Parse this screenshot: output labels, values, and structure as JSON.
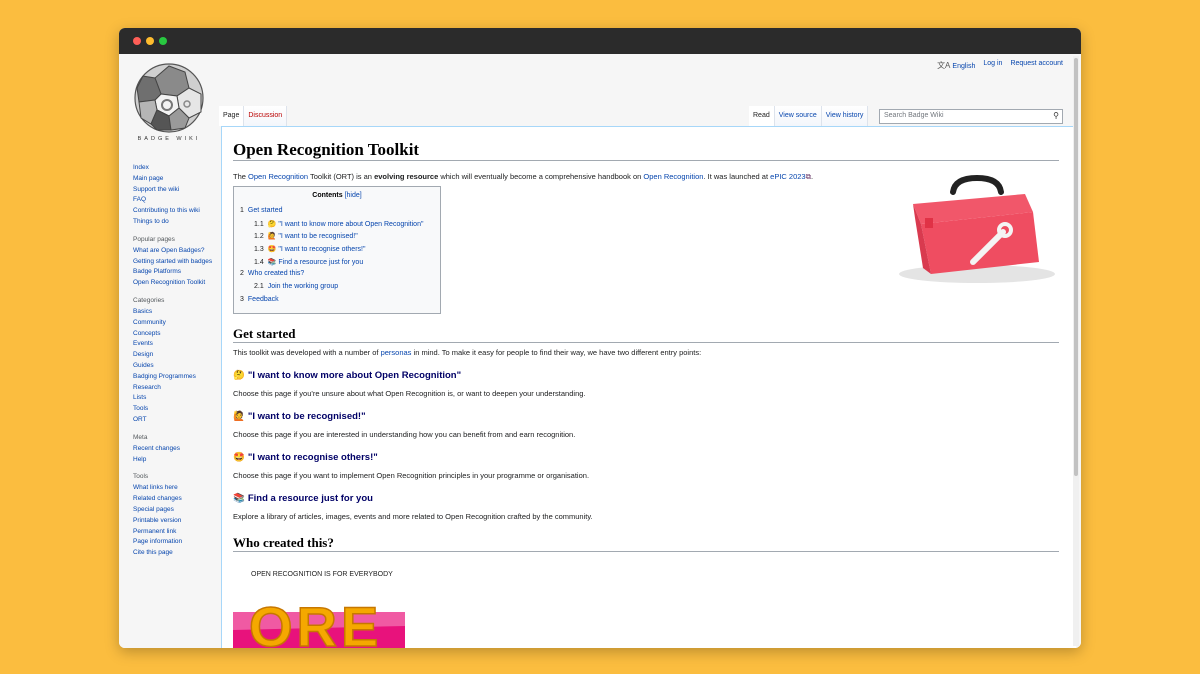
{
  "personal": {
    "language": "English",
    "login": "Log in",
    "request": "Request account"
  },
  "logo": {
    "text": "BADGE WIKI"
  },
  "tabs": {
    "page": "Page",
    "discussion": "Discussion",
    "read": "Read",
    "view_source": "View source",
    "view_history": "View history"
  },
  "search": {
    "placeholder": "Search Badge Wiki"
  },
  "sidebar": {
    "nav": [
      "Index",
      "Main page",
      "Support the wiki",
      "FAQ",
      "Contributing to this wiki",
      "Things to do"
    ],
    "popular_heading": "Popular pages",
    "popular": [
      "What are Open Badges?",
      "Getting started with badges",
      "Badge Platforms",
      "Open Recognition Toolkit"
    ],
    "categories_heading": "Categories",
    "categories": [
      "Basics",
      "Community",
      "Concepts",
      "Events",
      "Design",
      "Guides",
      "Badging Programmes",
      "Research",
      "Lists",
      "Tools",
      "ORT"
    ],
    "meta_heading": "Meta",
    "meta": [
      "Recent changes",
      "Help"
    ],
    "tools_heading": "Tools",
    "tools": [
      "What links here",
      "Related changes",
      "Special pages",
      "Printable version",
      "Permanent link",
      "Page information",
      "Cite this page"
    ]
  },
  "page": {
    "title": "Open Recognition Toolkit",
    "intro": {
      "t1": "The ",
      "l1": "Open Recognition",
      "t2": " Toolkit (ORT) is an ",
      "b1": "evolving resource",
      "t3": " which will eventually become a comprehensive handbook on ",
      "l2": "Open Recognition",
      "t4": ". It was launched at ",
      "l3": "ePIC 2023",
      "t5": "."
    },
    "toc": {
      "title": "Contents",
      "hide": "[hide]",
      "items": [
        {
          "num": "1",
          "text": "Get started"
        },
        {
          "num": "1.1",
          "text": "🤔 \"I want to know more about Open Recognition\""
        },
        {
          "num": "1.2",
          "text": "🙋 \"I want to be recognised!\""
        },
        {
          "num": "1.3",
          "text": "🤩 \"I want to recognise others!\""
        },
        {
          "num": "1.4",
          "text": "📚 Find a resource just for you"
        },
        {
          "num": "2",
          "text": "Who created this?"
        },
        {
          "num": "2.1",
          "text": "Join the working group"
        },
        {
          "num": "3",
          "text": "Feedback"
        }
      ]
    },
    "get_started": {
      "heading": "Get started",
      "p_t1": "This toolkit was developed with a number of ",
      "p_l1": "personas",
      "p_t2": " in mind. To make it easy for people to find their way, we have two different entry points:"
    },
    "sections": [
      {
        "emoji": "🤔",
        "heading": "\"I want to know more about Open Recognition\"",
        "text": "Choose this page if you're unsure about what Open Recognition is, or want to deepen your understanding."
      },
      {
        "emoji": "🙋",
        "heading": "\"I want to be recognised!\"",
        "text": "Choose this page if you are interested in understanding how you can benefit from and earn recognition."
      },
      {
        "emoji": "🤩",
        "heading": "\"I want to recognise others!\"",
        "text": "Choose this page if you want to implement Open Recognition principles in your programme or organisation."
      },
      {
        "emoji": "📚",
        "heading": "Find a resource just for you",
        "text": "Explore a library of articles, images, events and more related to Open Recognition crafted by the community."
      }
    ],
    "who_created": {
      "heading": "Who created this?"
    },
    "ore_image": {
      "caption": "OPEN RECOGNITION IS FOR EVERYBODY",
      "letters": "ORE"
    }
  }
}
